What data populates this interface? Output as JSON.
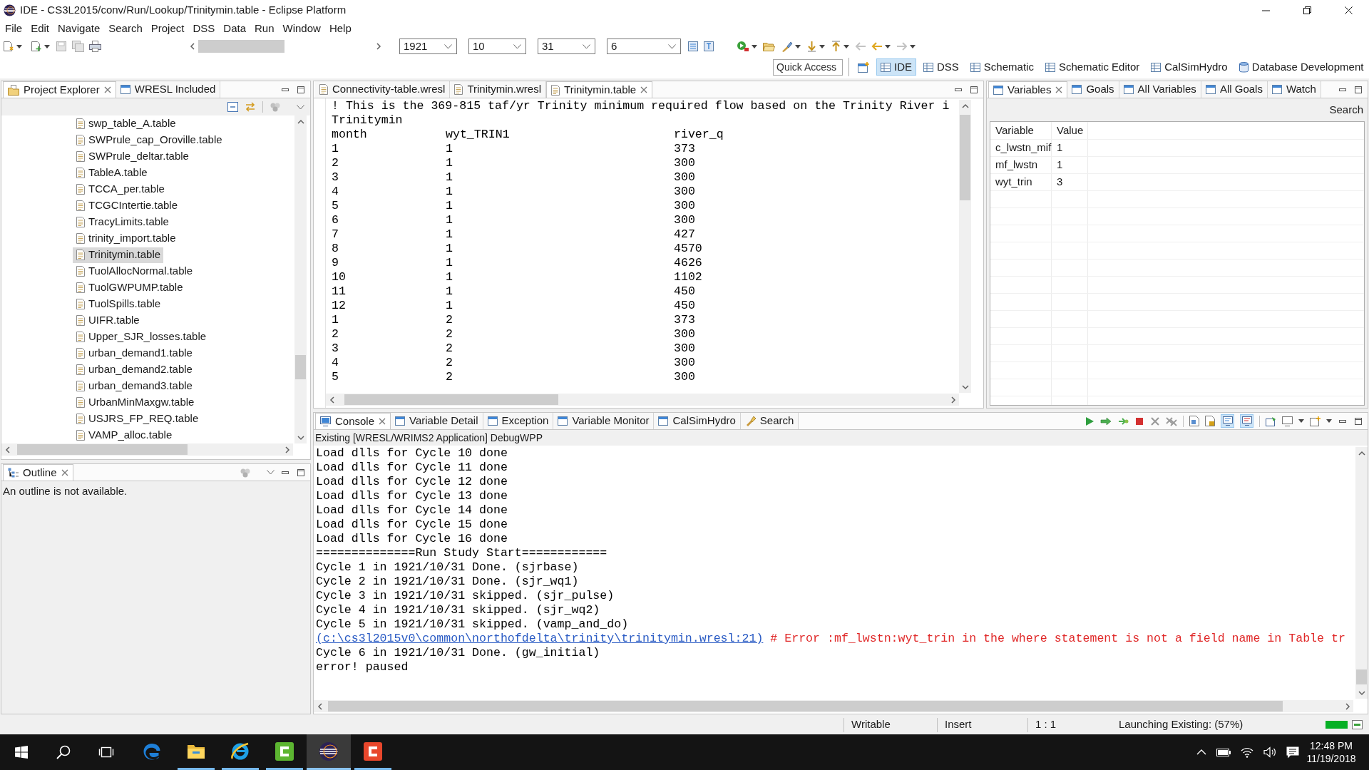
{
  "window": {
    "title": "IDE - CS3L2015/conv/Run/Lookup/Trinitymin.table - Eclipse Platform"
  },
  "menu_bar": [
    "File",
    "Edit",
    "Navigate",
    "Search",
    "Project",
    "DSS",
    "Data",
    "Run",
    "Window",
    "Help"
  ],
  "toolbar": {
    "dropdowns": [
      {
        "value": "1921"
      },
      {
        "value": "10"
      },
      {
        "value": "31"
      },
      {
        "value": "6"
      }
    ]
  },
  "quick_access": {
    "placeholder": "Quick Access"
  },
  "perspectives": [
    {
      "label": "IDE",
      "selected": true
    },
    {
      "label": "DSS",
      "selected": false
    },
    {
      "label": "Schematic",
      "selected": false
    },
    {
      "label": "Schematic Editor",
      "selected": false
    },
    {
      "label": "CalSimHydro",
      "selected": false
    },
    {
      "label": "Database Development",
      "selected": false
    }
  ],
  "project_explorer": {
    "tabs": [
      {
        "label": "Project Explorer",
        "selected": true
      },
      {
        "label": "WRESL Included",
        "selected": false
      }
    ],
    "files": [
      {
        "name": "swp_table_A.table",
        "selected": false
      },
      {
        "name": "SWPrule_cap_Oroville.table",
        "selected": false
      },
      {
        "name": "SWPrule_deltar.table",
        "selected": false
      },
      {
        "name": "TableA.table",
        "selected": false
      },
      {
        "name": "TCCA_per.table",
        "selected": false
      },
      {
        "name": "TCGCIntertie.table",
        "selected": false
      },
      {
        "name": "TracyLimits.table",
        "selected": false
      },
      {
        "name": "trinity_import.table",
        "selected": false
      },
      {
        "name": "Trinitymin.table",
        "selected": true
      },
      {
        "name": "TuolAllocNormal.table",
        "selected": false
      },
      {
        "name": "TuolGWPUMP.table",
        "selected": false
      },
      {
        "name": "TuolSpills.table",
        "selected": false
      },
      {
        "name": "UIFR.table",
        "selected": false
      },
      {
        "name": "Upper_SJR_losses.table",
        "selected": false
      },
      {
        "name": "urban_demand1.table",
        "selected": false
      },
      {
        "name": "urban_demand2.table",
        "selected": false
      },
      {
        "name": "urban_demand3.table",
        "selected": false
      },
      {
        "name": "UrbanMinMaxgw.table",
        "selected": false
      },
      {
        "name": "USJRS_FP_REQ.table",
        "selected": false
      },
      {
        "name": "VAMP_alloc.table",
        "selected": false
      }
    ]
  },
  "outline": {
    "tabs": [
      {
        "label": "Outline",
        "selected": true
      }
    ],
    "message": "An outline is not available."
  },
  "editor": {
    "tabs": [
      {
        "label": "Connectivity-table.wresl",
        "selected": false
      },
      {
        "label": "Trinitymin.wresl",
        "selected": false
      },
      {
        "label": "Trinitymin.table",
        "selected": true
      }
    ],
    "comment": "! This is the 369-815 taf/yr Trinity minimum required flow based on the Trinity River i",
    "table_name": "Trinitymin",
    "columns": [
      "month",
      "wyt_TRIN1",
      "river_q"
    ],
    "rows": [
      [
        "1",
        "1",
        "373"
      ],
      [
        "2",
        "1",
        "300"
      ],
      [
        "3",
        "1",
        "300"
      ],
      [
        "4",
        "1",
        "300"
      ],
      [
        "5",
        "1",
        "300"
      ],
      [
        "6",
        "1",
        "300"
      ],
      [
        "7",
        "1",
        "427"
      ],
      [
        "8",
        "1",
        "4570"
      ],
      [
        "9",
        "1",
        "4626"
      ],
      [
        "10",
        "1",
        "1102"
      ],
      [
        "11",
        "1",
        "450"
      ],
      [
        "12",
        "1",
        "450"
      ],
      [
        "1",
        "2",
        "373"
      ],
      [
        "2",
        "2",
        "300"
      ],
      [
        "3",
        "2",
        "300"
      ],
      [
        "4",
        "2",
        "300"
      ],
      [
        "5",
        "2",
        "300"
      ]
    ]
  },
  "variables": {
    "tabs": [
      {
        "label": "Variables",
        "selected": true
      },
      {
        "label": "Goals",
        "selected": false
      },
      {
        "label": "All Variables",
        "selected": false
      },
      {
        "label": "All Goals",
        "selected": false
      },
      {
        "label": "Watch",
        "selected": false
      }
    ],
    "search_label": "Search",
    "columns": [
      "Variable",
      "Value"
    ],
    "rows": [
      [
        "c_lwstn_mif",
        "1"
      ],
      [
        "mf_lwstn",
        "1"
      ],
      [
        "wyt_trin",
        "3"
      ]
    ]
  },
  "console": {
    "tabs": [
      {
        "label": "Console",
        "selected": true
      },
      {
        "label": "Variable Detail",
        "selected": false
      },
      {
        "label": "Exception",
        "selected": false
      },
      {
        "label": "Variable Monitor",
        "selected": false
      },
      {
        "label": "CalSimHydro",
        "selected": false
      },
      {
        "label": "Search",
        "selected": false
      }
    ],
    "process_label": "Existing [WRESL/WRIMS2 Application] DebugWPP",
    "lines": [
      {
        "kind": "output",
        "text": "Load dlls for Cycle 10 done"
      },
      {
        "kind": "output",
        "text": "Load dlls for Cycle 11 done"
      },
      {
        "kind": "output",
        "text": "Load dlls for Cycle 12 done"
      },
      {
        "kind": "output",
        "text": "Load dlls for Cycle 13 done"
      },
      {
        "kind": "output",
        "text": "Load dlls for Cycle 14 done"
      },
      {
        "kind": "output",
        "text": "Load dlls for Cycle 15 done"
      },
      {
        "kind": "output",
        "text": "Load dlls for Cycle 16 done"
      },
      {
        "kind": "output",
        "text": "==============Run Study Start============"
      },
      {
        "kind": "output",
        "text": "Cycle 1 in 1921/10/31 Done. (sjrbase)"
      },
      {
        "kind": "output",
        "text": "Cycle 2 in 1921/10/31 Done. (sjr_wq1)"
      },
      {
        "kind": "output",
        "text": "Cycle 3 in 1921/10/31 skipped. (sjr_pulse)"
      },
      {
        "kind": "output",
        "text": "Cycle 4 in 1921/10/31 skipped. (sjr_wq2)"
      },
      {
        "kind": "output",
        "text": "Cycle 5 in 1921/10/31 skipped. (vamp_and_do)"
      },
      {
        "kind": "error",
        "link": "(c:\\cs3l2015v0\\common\\northofdelta\\trinity\\trinitymin.wresl:21)",
        "text": " # Error :mf_lwstn:wyt_trin in the where statement is not a field name in Table tr"
      },
      {
        "kind": "output",
        "text": "Cycle 6 in 1921/10/31 Done. (gw_initial)"
      },
      {
        "kind": "output",
        "text": "error! paused"
      }
    ]
  },
  "status_bar": {
    "fields": [
      "Writable",
      "Insert",
      "1 : 1"
    ],
    "progress": {
      "label": "Launching Existing: (57%)",
      "level": 1
    }
  },
  "taskbar": {
    "apps": [
      {
        "running": false,
        "selected": false
      },
      {
        "running": true,
        "selected": false
      },
      {
        "running": true,
        "selected": false
      },
      {
        "running": true,
        "selected": false
      },
      {
        "running": true,
        "selected": true
      },
      {
        "running": true,
        "selected": false
      }
    ],
    "clock": {
      "time": "12:48 PM",
      "date": "11/19/2018"
    }
  }
}
